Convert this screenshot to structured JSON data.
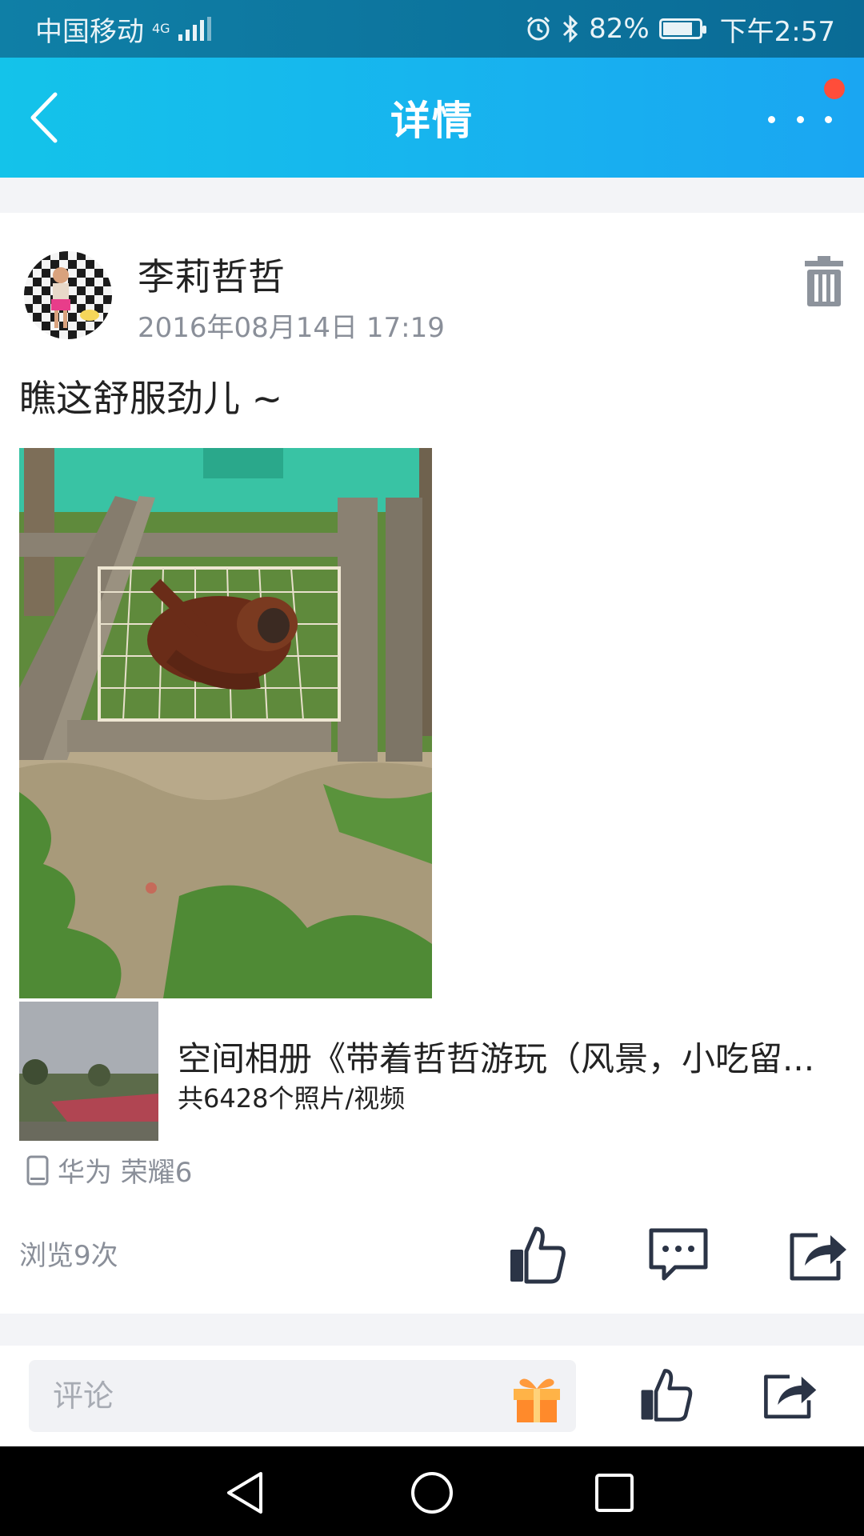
{
  "status_bar": {
    "carrier": "中国移动",
    "network": "4G",
    "battery": "82%",
    "battery_level": 0.82,
    "time": "下午2:57"
  },
  "header": {
    "title": "详情"
  },
  "post": {
    "username": "李莉哲哲",
    "time": "2016年08月14日 17:19",
    "text": "瞧这舒服劲儿 ~",
    "album_title": "空间相册《带着哲哲游玩（风景，小吃留...",
    "album_count": "共6428个照片/视频",
    "device": "华为 荣耀6",
    "views": "浏览9次"
  },
  "comment_bar": {
    "placeholder": "评论"
  },
  "colors": {
    "header_start": "#14c3ea",
    "header_end": "#1aa6f2",
    "status_bar": "#0f7fa6",
    "notification_dot": "#ff4d3a",
    "icon_dark": "#2b3446",
    "muted_text": "#8a8f99"
  },
  "icons": {
    "back": "back-arrow-icon",
    "more": "more-dots-icon",
    "delete": "trash-icon",
    "device": "phone-icon",
    "like": "thumbs-up-icon",
    "comment": "comment-icon",
    "share": "share-icon",
    "gift": "gift-icon"
  }
}
